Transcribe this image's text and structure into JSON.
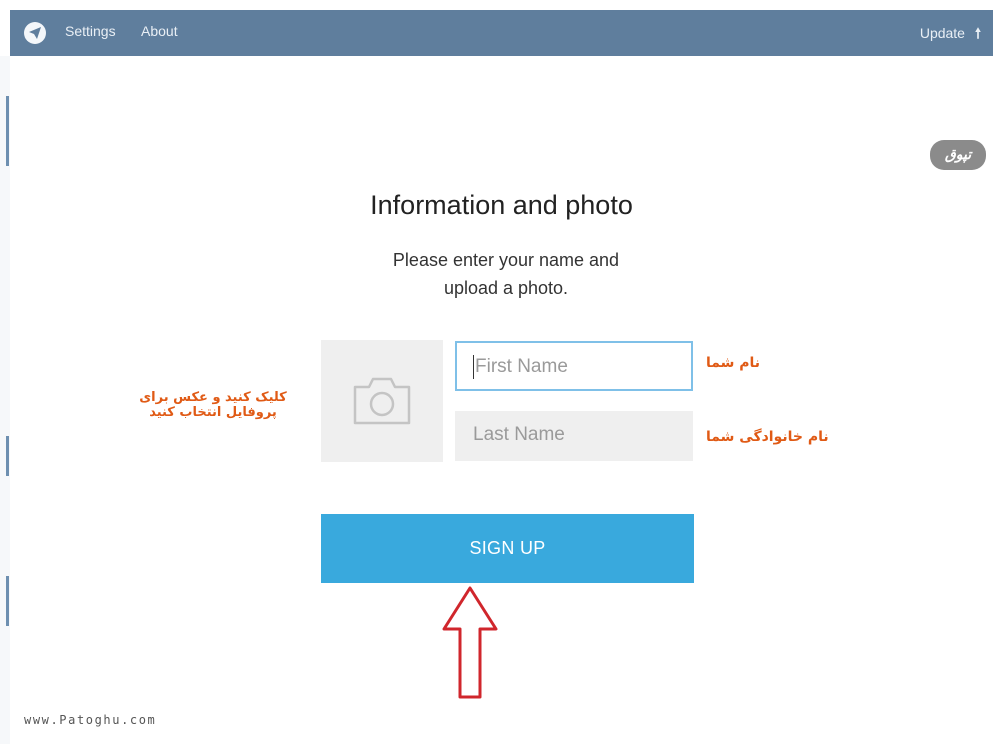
{
  "window": {
    "menu": {
      "settings": "Settings",
      "about": "About"
    },
    "update": {
      "label": "Update",
      "arrow": "🠕"
    }
  },
  "watermark": {
    "logo_text": "تپوق",
    "url": "www.Patoghu.com"
  },
  "signup_form": {
    "title": "Information and photo",
    "subtitle": "Please enter your name and upload a photo.",
    "first_name": {
      "placeholder": "First Name",
      "value": ""
    },
    "last_name": {
      "placeholder": "Last Name",
      "value": ""
    },
    "submit_label": "SIGN UP"
  },
  "annotations": {
    "first_name": "نام شما",
    "last_name": "نام خانوادگی شما",
    "photo": "کلیک کنید و عکس برای پروفایل انتخاب کنید",
    "arrow_color": "#d0262c"
  },
  "colors": {
    "titlebar": "#5f7e9d",
    "accent": "#39a9dd",
    "annotation": "#e05a15"
  },
  "icons": [
    "telegram-logo-icon",
    "camera-icon",
    "up-arrow-icon",
    "pointer-arrow-icon"
  ]
}
